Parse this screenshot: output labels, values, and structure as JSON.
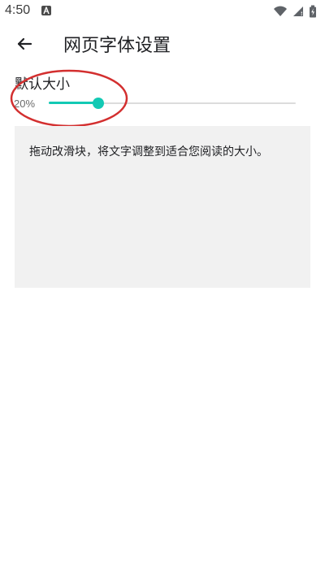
{
  "status_bar": {
    "time": "4:50",
    "app_icon": "a-letter-icon",
    "right_icons": [
      "wifi-icon",
      "cell-signal-icon",
      "battery-icon"
    ]
  },
  "toolbar": {
    "back_icon": "arrow-left-icon",
    "title": "网页字体设置"
  },
  "setting": {
    "label": "默认大小",
    "percent_text": "20%",
    "slider_value_percent": 20
  },
  "preview": {
    "text": "拖动改滑块，将文字调整到适合您阅读的大小。"
  },
  "colors": {
    "accent": "#13c9b4",
    "annotation": "#d32f2f",
    "preview_bg": "#f1f1f1"
  }
}
